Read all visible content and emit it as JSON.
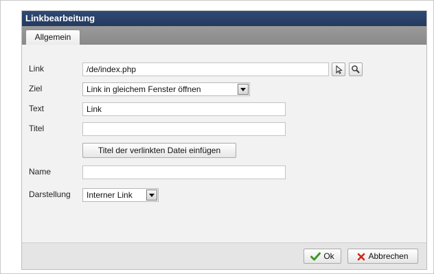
{
  "dialog": {
    "title": "Linkbearbeitung",
    "tabs": [
      {
        "label": "Allgemein",
        "active": true
      }
    ]
  },
  "form": {
    "link": {
      "label": "Link",
      "value": "/de/index.php"
    },
    "ziel": {
      "label": "Ziel",
      "selected": "Link in gleichem Fenster öffnen"
    },
    "text": {
      "label": "Text",
      "value": "Link"
    },
    "titel": {
      "label": "Titel",
      "value": ""
    },
    "insert_title_button": "Titel der verlinkten Datei einfügen",
    "name": {
      "label": "Name",
      "value": ""
    },
    "darstellung": {
      "label": "Darstellung",
      "selected": "Interner Link"
    }
  },
  "footer": {
    "ok_label": "Ok",
    "cancel_label": "Abbrechen"
  },
  "colors": {
    "titlebar": "#2f4a74",
    "tabstrip": "#8f8f8f",
    "ok_check": "#3a9a1f",
    "cancel_x": "#d0261c"
  },
  "icons": [
    "pointer-icon",
    "search-icon",
    "chevron-down-icon",
    "check-icon",
    "close-icon"
  ]
}
